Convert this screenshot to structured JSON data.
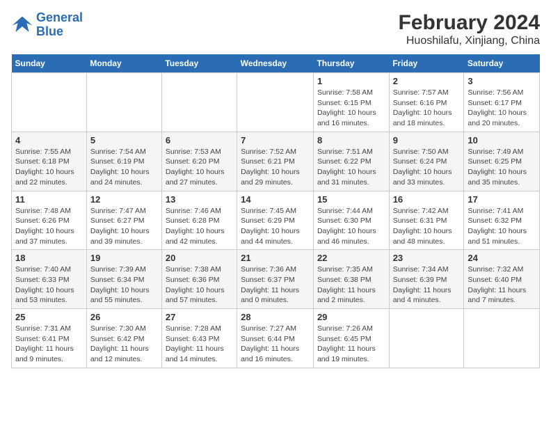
{
  "logo": {
    "line1": "General",
    "line2": "Blue"
  },
  "title": "February 2024",
  "subtitle": "Huoshilafu, Xinjiang, China",
  "days_of_week": [
    "Sunday",
    "Monday",
    "Tuesday",
    "Wednesday",
    "Thursday",
    "Friday",
    "Saturday"
  ],
  "weeks": [
    [
      {
        "day": "",
        "info": ""
      },
      {
        "day": "",
        "info": ""
      },
      {
        "day": "",
        "info": ""
      },
      {
        "day": "",
        "info": ""
      },
      {
        "day": "1",
        "info": "Sunrise: 7:58 AM\nSunset: 6:15 PM\nDaylight: 10 hours\nand 16 minutes."
      },
      {
        "day": "2",
        "info": "Sunrise: 7:57 AM\nSunset: 6:16 PM\nDaylight: 10 hours\nand 18 minutes."
      },
      {
        "day": "3",
        "info": "Sunrise: 7:56 AM\nSunset: 6:17 PM\nDaylight: 10 hours\nand 20 minutes."
      }
    ],
    [
      {
        "day": "4",
        "info": "Sunrise: 7:55 AM\nSunset: 6:18 PM\nDaylight: 10 hours\nand 22 minutes."
      },
      {
        "day": "5",
        "info": "Sunrise: 7:54 AM\nSunset: 6:19 PM\nDaylight: 10 hours\nand 24 minutes."
      },
      {
        "day": "6",
        "info": "Sunrise: 7:53 AM\nSunset: 6:20 PM\nDaylight: 10 hours\nand 27 minutes."
      },
      {
        "day": "7",
        "info": "Sunrise: 7:52 AM\nSunset: 6:21 PM\nDaylight: 10 hours\nand 29 minutes."
      },
      {
        "day": "8",
        "info": "Sunrise: 7:51 AM\nSunset: 6:22 PM\nDaylight: 10 hours\nand 31 minutes."
      },
      {
        "day": "9",
        "info": "Sunrise: 7:50 AM\nSunset: 6:24 PM\nDaylight: 10 hours\nand 33 minutes."
      },
      {
        "day": "10",
        "info": "Sunrise: 7:49 AM\nSunset: 6:25 PM\nDaylight: 10 hours\nand 35 minutes."
      }
    ],
    [
      {
        "day": "11",
        "info": "Sunrise: 7:48 AM\nSunset: 6:26 PM\nDaylight: 10 hours\nand 37 minutes."
      },
      {
        "day": "12",
        "info": "Sunrise: 7:47 AM\nSunset: 6:27 PM\nDaylight: 10 hours\nand 39 minutes."
      },
      {
        "day": "13",
        "info": "Sunrise: 7:46 AM\nSunset: 6:28 PM\nDaylight: 10 hours\nand 42 minutes."
      },
      {
        "day": "14",
        "info": "Sunrise: 7:45 AM\nSunset: 6:29 PM\nDaylight: 10 hours\nand 44 minutes."
      },
      {
        "day": "15",
        "info": "Sunrise: 7:44 AM\nSunset: 6:30 PM\nDaylight: 10 hours\nand 46 minutes."
      },
      {
        "day": "16",
        "info": "Sunrise: 7:42 AM\nSunset: 6:31 PM\nDaylight: 10 hours\nand 48 minutes."
      },
      {
        "day": "17",
        "info": "Sunrise: 7:41 AM\nSunset: 6:32 PM\nDaylight: 10 hours\nand 51 minutes."
      }
    ],
    [
      {
        "day": "18",
        "info": "Sunrise: 7:40 AM\nSunset: 6:33 PM\nDaylight: 10 hours\nand 53 minutes."
      },
      {
        "day": "19",
        "info": "Sunrise: 7:39 AM\nSunset: 6:34 PM\nDaylight: 10 hours\nand 55 minutes."
      },
      {
        "day": "20",
        "info": "Sunrise: 7:38 AM\nSunset: 6:36 PM\nDaylight: 10 hours\nand 57 minutes."
      },
      {
        "day": "21",
        "info": "Sunrise: 7:36 AM\nSunset: 6:37 PM\nDaylight: 11 hours\nand 0 minutes."
      },
      {
        "day": "22",
        "info": "Sunrise: 7:35 AM\nSunset: 6:38 PM\nDaylight: 11 hours\nand 2 minutes."
      },
      {
        "day": "23",
        "info": "Sunrise: 7:34 AM\nSunset: 6:39 PM\nDaylight: 11 hours\nand 4 minutes."
      },
      {
        "day": "24",
        "info": "Sunrise: 7:32 AM\nSunset: 6:40 PM\nDaylight: 11 hours\nand 7 minutes."
      }
    ],
    [
      {
        "day": "25",
        "info": "Sunrise: 7:31 AM\nSunset: 6:41 PM\nDaylight: 11 hours\nand 9 minutes."
      },
      {
        "day": "26",
        "info": "Sunrise: 7:30 AM\nSunset: 6:42 PM\nDaylight: 11 hours\nand 12 minutes."
      },
      {
        "day": "27",
        "info": "Sunrise: 7:28 AM\nSunset: 6:43 PM\nDaylight: 11 hours\nand 14 minutes."
      },
      {
        "day": "28",
        "info": "Sunrise: 7:27 AM\nSunset: 6:44 PM\nDaylight: 11 hours\nand 16 minutes."
      },
      {
        "day": "29",
        "info": "Sunrise: 7:26 AM\nSunset: 6:45 PM\nDaylight: 11 hours\nand 19 minutes."
      },
      {
        "day": "",
        "info": ""
      },
      {
        "day": "",
        "info": ""
      }
    ]
  ]
}
